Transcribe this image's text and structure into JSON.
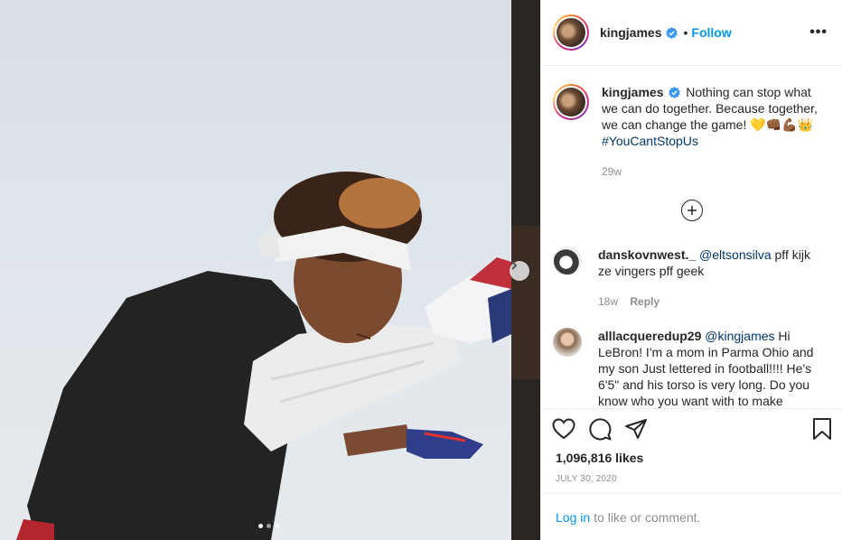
{
  "post": {
    "username": "kingjames",
    "separator": "•",
    "follow_label": "Follow",
    "more_label": "•••"
  },
  "caption": {
    "username": "kingjames",
    "text": "Nothing can stop what we can do together. Because together, we can change the game! 💛👊🏾💪🏾👑",
    "hashtag": "#YouCantStopUs",
    "time": "29w"
  },
  "comments": [
    {
      "username": "danskovnwest._",
      "mention": "@eltsonsilva",
      "text": "pff kijk ze vingers pff geek",
      "time": "18w",
      "reply_label": "Reply"
    },
    {
      "username": "alllacqueredup29",
      "mention": "@kingjames",
      "text": "Hi LeBron! I'm a mom in Parma Ohio and my son Just lettered in football!!!! He's 6'5\" and his torso is very long. Do you know who you want with to make"
    }
  ],
  "likes": "1,096,816 likes",
  "date": "JULY 30, 2020",
  "login": {
    "link": "Log in",
    "text": "to like or comment."
  },
  "carousel": {
    "slide_count": 3,
    "active_index": 0
  },
  "colors": {
    "accent": "#0095f6",
    "verified": "#3897f0",
    "muted": "#8e8e8e"
  }
}
